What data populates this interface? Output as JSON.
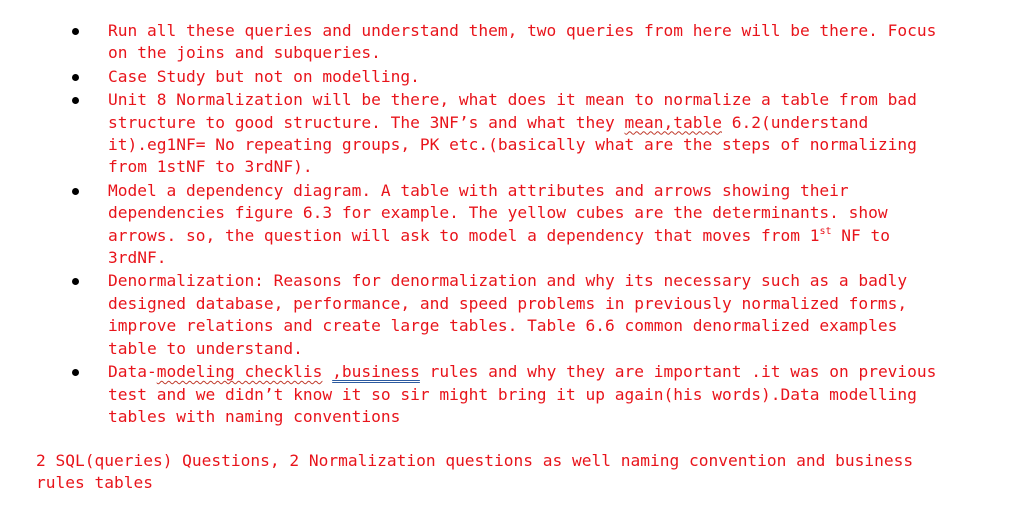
{
  "bullets": [
    {
      "text": "Run all these queries and understand them, two queries from here will be there. Focus on the joins and subqueries."
    },
    {
      "text": "Case Study but not on modelling."
    },
    {
      "text_a": "Unit 8 Normalization will be there, what does it mean to normalize a table from bad structure to good structure. The 3NF’s and what they ",
      "text_squiggle": "mean,table",
      "text_b": " 6.2(understand it).eg1NF= No repeating groups, PK etc.(basically what are the steps of normalizing from 1stNF  to 3rdNF)."
    },
    {
      "text_a": "Model a dependency diagram. A table with attributes and arrows showing their dependencies figure 6.3 for example. The yellow cubes are the determinants. show arrows. so, the question will ask to model a dependency that moves from 1",
      "sup": "st",
      "text_b": " NF to 3rdNF."
    },
    {
      "text": "Denormalization: Reasons for denormalization and why its necessary such as a badly designed database, performance, and speed problems in previously normalized forms, improve relations and create large tables. Table 6.6 common denormalized examples table to understand."
    },
    {
      "text_a": "Data-",
      "text_squiggle": "modeling checklis",
      "text_mid": " ",
      "text_blue": ",business",
      "text_b": " rules and why they are important .it was on previous test and we didn’t know it so sir might bring it up again(his words).Data modelling tables with naming conventions"
    }
  ],
  "summary": "2 SQL(queries) Questions, 2 Normalization questions as well naming convention and business rules tables",
  "colors": {
    "text": "#e8141b",
    "bullet": "#000000",
    "background": "#ffffff"
  }
}
